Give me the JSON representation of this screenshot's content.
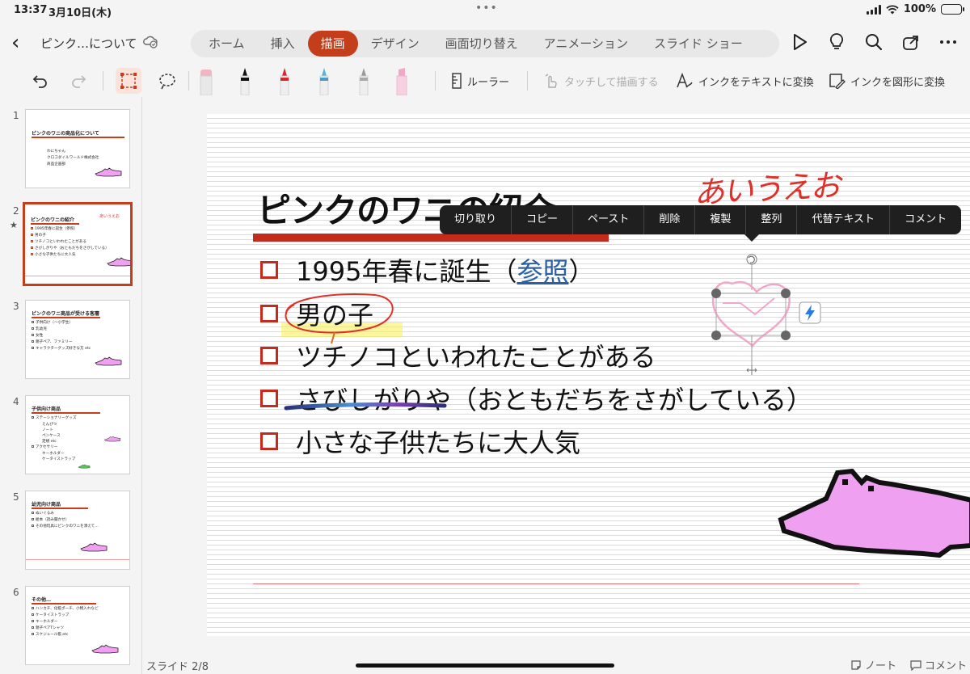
{
  "status": {
    "time": "13:37",
    "date": "3月10日(木)",
    "battery": "100%"
  },
  "header": {
    "doc_title": "ピンク…について",
    "tabs": [
      {
        "label": "ホーム"
      },
      {
        "label": "挿入"
      },
      {
        "label": "描画",
        "active": true
      },
      {
        "label": "デザイン"
      },
      {
        "label": "画面切り替え"
      },
      {
        "label": "アニメーション"
      },
      {
        "label": "スライド ショー"
      }
    ]
  },
  "ribbon": {
    "ruler": "ルーラー",
    "touch_draw": "タッチして描画する",
    "ink_to_text": "インクをテキストに変換",
    "ink_to_shape": "インクを図形に変換"
  },
  "context_menu": [
    "切り取り",
    "コピー",
    "ペースト",
    "削除",
    "複製",
    "整列",
    "代替テキスト",
    "コメント"
  ],
  "slide": {
    "title": "ピンクのワニの紹介",
    "bullets": [
      {
        "text": "1995年春に誕生（",
        "link": "参照",
        "after": "）"
      },
      {
        "text": "男の子"
      },
      {
        "text": "ツチノコといわれたことがある"
      },
      {
        "text": "さびしがりや（おともだちをさがしている）"
      },
      {
        "text": "小さな子供たちに大人気"
      }
    ],
    "handwriting": "あいうえお"
  },
  "thumbnails": [
    {
      "num": "1",
      "title": "ピンクのワニの商品化について",
      "lines": [
        "わにちゃん",
        "クロコダイルワールド株式会社",
        "商品企画部"
      ]
    },
    {
      "num": "2",
      "title": "ピンクのワニの紹介",
      "lines": [
        "1995年春に誕生（参照）",
        "男の子",
        "ツチノコといわれたことがある",
        "さびしがりや（おともだちをさがしている）",
        "小さな子供たちに大人気"
      ],
      "handwriting": "あいうえお"
    },
    {
      "num": "3",
      "title": "ピンクのワニ商品が受ける客層",
      "lines": [
        "子供向け（〜小学生）",
        "乳幼児",
        "女性",
        "親子ペア、ファミリー",
        "キャラクターグッズ好きな方 etc"
      ]
    },
    {
      "num": "4",
      "title": "子供向け商品",
      "lines": [
        "ステーショナリーグッズ",
        "えんぴつ",
        "ノート",
        "ペンケース",
        "定規 etc",
        "アクセサリー",
        "キーホルダー",
        "ケータイストラップ"
      ]
    },
    {
      "num": "5",
      "title": "幼児向け商品",
      "lines": [
        "ぬいぐるみ",
        "絵本（読み聞かせ）",
        "その他玩具にピンクのワニを添えて…"
      ]
    },
    {
      "num": "6",
      "title": "その他…",
      "lines": [
        "ハンカチ、化粧ポーチ、小物入れなど",
        "ケータイストラップ",
        "キーホルダー",
        "親子ペアTシャツ",
        "スケジュール帳 etc"
      ]
    }
  ],
  "footer": {
    "slide_count": "スライド 2/8",
    "notes": "ノート",
    "comments": "コメント"
  }
}
